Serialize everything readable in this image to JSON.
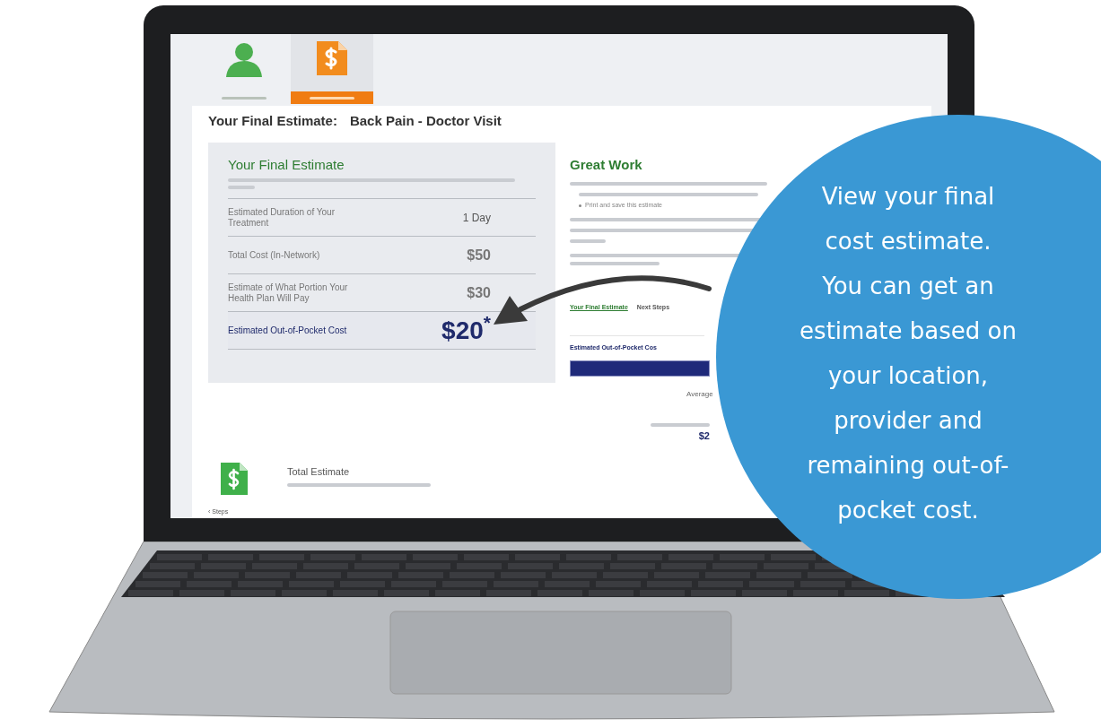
{
  "steps": [
    {
      "kind": "person",
      "selected": false
    },
    {
      "kind": "estimate",
      "selected": true
    }
  ],
  "headline": {
    "label": "Your Final Estimate:",
    "title": "Back Pain - Doctor Visit"
  },
  "estimate_card": {
    "title": "Your Final Estimate",
    "rows": [
      {
        "label": "Estimated Duration of Your Treatment",
        "value": "1 Day",
        "emphasis": false
      },
      {
        "label": "Total Cost (In-Network)",
        "value": "$50",
        "emphasis": false
      },
      {
        "label": "Estimate of What Portion Your Health Plan Will Pay",
        "value": "$30",
        "emphasis": false
      },
      {
        "label": "Estimated Out-of-Pocket Cost",
        "value": "$20$^{*}$",
        "emphasis": true
      }
    ]
  },
  "summary": {
    "title": "Great Work",
    "bullets": [
      "Print and save this estimate"
    ],
    "links": [
      {
        "label": "Your Final Estimate",
        "selected": true
      },
      {
        "label": "Next Steps",
        "selected": false
      }
    ],
    "chart_title": "Estimated Out-of-Pocket Cos",
    "average_label": "Average",
    "total_value": "$2"
  },
  "total": {
    "title": "Total Estimate",
    "back": "‹ Steps"
  },
  "callout": {
    "lines": [
      "View your final",
      "cost estimate.",
      "You can get an",
      "estimate based on",
      "your location,",
      "provider and",
      "remaining out-of-",
      "pocket cost."
    ]
  }
}
